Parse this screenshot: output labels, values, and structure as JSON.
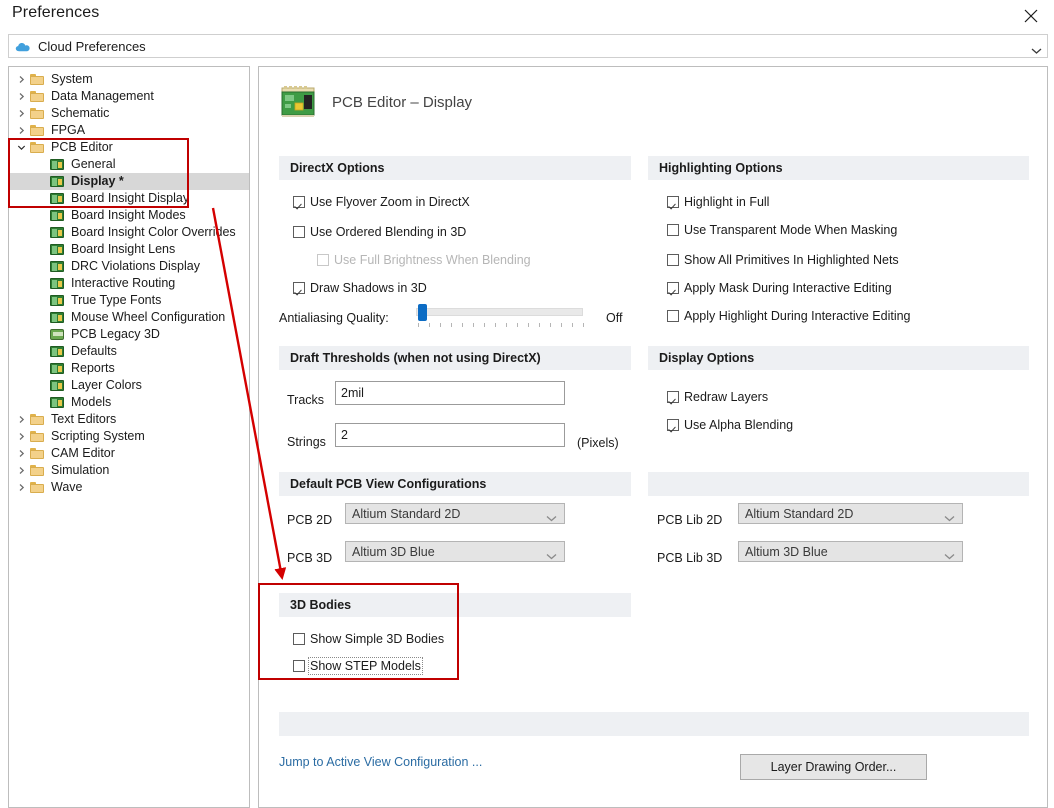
{
  "window": {
    "title": "Preferences",
    "close_icon": "close-icon"
  },
  "cloud_bar": {
    "label": "Cloud Preferences",
    "icon": "cloud-icon",
    "chevron_icon": "chevron-down-icon"
  },
  "tree": {
    "items": [
      {
        "label": "System",
        "icon": "folder-icon",
        "indent": 0,
        "expander": "collapsed",
        "selected": false
      },
      {
        "label": "Data Management",
        "icon": "folder-icon",
        "indent": 0,
        "expander": "collapsed",
        "selected": false
      },
      {
        "label": "Schematic",
        "icon": "folder-icon",
        "indent": 0,
        "expander": "collapsed",
        "selected": false
      },
      {
        "label": "FPGA",
        "icon": "folder-icon",
        "indent": 0,
        "expander": "collapsed",
        "selected": false
      },
      {
        "label": "PCB Editor",
        "icon": "folder-icon",
        "indent": 0,
        "expander": "expanded",
        "selected": false
      },
      {
        "label": "General",
        "icon": "pcb-chip-icon",
        "indent": 1,
        "expander": "none",
        "selected": false
      },
      {
        "label": "Display *",
        "icon": "pcb-chip-icon",
        "indent": 1,
        "expander": "none",
        "selected": true
      },
      {
        "label": "Board Insight Display",
        "icon": "pcb-chip-icon",
        "indent": 1,
        "expander": "none",
        "selected": false
      },
      {
        "label": "Board Insight Modes",
        "icon": "pcb-chip-icon",
        "indent": 1,
        "expander": "none",
        "selected": false
      },
      {
        "label": "Board Insight Color Overrides",
        "icon": "pcb-chip-icon",
        "indent": 1,
        "expander": "none",
        "selected": false
      },
      {
        "label": "Board Insight Lens",
        "icon": "pcb-chip-icon",
        "indent": 1,
        "expander": "none",
        "selected": false
      },
      {
        "label": "DRC Violations Display",
        "icon": "pcb-chip-icon",
        "indent": 1,
        "expander": "none",
        "selected": false
      },
      {
        "label": "Interactive Routing",
        "icon": "pcb-chip-icon",
        "indent": 1,
        "expander": "none",
        "selected": false
      },
      {
        "label": "True Type Fonts",
        "icon": "pcb-chip-icon",
        "indent": 1,
        "expander": "none",
        "selected": false
      },
      {
        "label": "Mouse Wheel Configuration",
        "icon": "pcb-chip-icon",
        "indent": 1,
        "expander": "none",
        "selected": false
      },
      {
        "label": "PCB Legacy 3D",
        "icon": "pcb-3d-icon",
        "indent": 1,
        "expander": "none",
        "selected": false
      },
      {
        "label": "Defaults",
        "icon": "pcb-chip-icon",
        "indent": 1,
        "expander": "none",
        "selected": false
      },
      {
        "label": "Reports",
        "icon": "pcb-chip-icon",
        "indent": 1,
        "expander": "none",
        "selected": false
      },
      {
        "label": "Layer Colors",
        "icon": "pcb-chip-icon",
        "indent": 1,
        "expander": "none",
        "selected": false
      },
      {
        "label": "Models",
        "icon": "pcb-chip-icon",
        "indent": 1,
        "expander": "none",
        "selected": false
      },
      {
        "label": "Text Editors",
        "icon": "folder-icon",
        "indent": 0,
        "expander": "collapsed",
        "selected": false
      },
      {
        "label": "Scripting System",
        "icon": "folder-icon",
        "indent": 0,
        "expander": "collapsed",
        "selected": false
      },
      {
        "label": "CAM Editor",
        "icon": "folder-icon",
        "indent": 0,
        "expander": "collapsed",
        "selected": false
      },
      {
        "label": "Simulation",
        "icon": "folder-icon",
        "indent": 0,
        "expander": "collapsed",
        "selected": false
      },
      {
        "label": "Wave",
        "icon": "folder-icon",
        "indent": 0,
        "expander": "collapsed",
        "selected": false
      }
    ]
  },
  "page": {
    "title": "PCB Editor – Display",
    "icon": "pcb-board-icon"
  },
  "directx": {
    "heading": "DirectX Options",
    "options": [
      {
        "label": "Use Flyover Zoom in DirectX",
        "checked": true,
        "disabled": false
      },
      {
        "label": "Use Ordered Blending in 3D",
        "checked": false,
        "disabled": false
      },
      {
        "label": "Use Full Brightness When Blending",
        "checked": false,
        "disabled": true
      },
      {
        "label": "Draw Shadows in 3D",
        "checked": true,
        "disabled": false
      }
    ],
    "antialiasing_label": "Antialiasing Quality:",
    "antialiasing_value": "Off",
    "antialiasing_position_percent": 0,
    "antialiasing_ticks": 16
  },
  "highlighting": {
    "heading": "Highlighting Options",
    "options": [
      {
        "label": "Highlight in Full",
        "checked": true
      },
      {
        "label": "Use Transparent Mode When Masking",
        "checked": false
      },
      {
        "label": "Show All Primitives In Highlighted Nets",
        "checked": false
      },
      {
        "label": "Apply Mask During Interactive Editing",
        "checked": true
      },
      {
        "label": "Apply Highlight During Interactive Editing",
        "checked": false
      }
    ]
  },
  "draft_thresholds": {
    "heading": "Draft Thresholds (when not using DirectX)",
    "tracks_label": "Tracks",
    "tracks_value": "2mil",
    "strings_label": "Strings",
    "strings_value": "2",
    "units_suffix": "(Pixels)"
  },
  "display_options": {
    "heading": "Display Options",
    "options": [
      {
        "label": "Redraw Layers",
        "checked": true
      },
      {
        "label": "Use Alpha Blending",
        "checked": true
      }
    ]
  },
  "view_configs": {
    "heading": "Default PCB View Configurations",
    "rows": [
      {
        "label": "PCB 2D",
        "value": "Altium Standard 2D"
      },
      {
        "label": "PCB 3D",
        "value": "Altium 3D Blue"
      }
    ]
  },
  "lib_configs": {
    "heading": "",
    "rows": [
      {
        "label": "PCB Lib 2D",
        "value": "Altium Standard 2D"
      },
      {
        "label": "PCB Lib 3D",
        "value": "Altium 3D Blue"
      }
    ]
  },
  "bodies_3d": {
    "heading": "3D Bodies",
    "options": [
      {
        "label": "Show Simple 3D Bodies",
        "checked": false,
        "focused": false
      },
      {
        "label": "Show STEP Models",
        "checked": false,
        "focused": true
      }
    ]
  },
  "footer": {
    "jump_link": "Jump to Active View Configuration ...",
    "layer_button": "Layer Drawing Order..."
  },
  "annotations": {
    "highlight_color": "#c00000",
    "arrow_color": "#d40000",
    "boxes": [
      {
        "name": "tree-highlight-box"
      },
      {
        "name": "3d-bodies-highlight-box"
      }
    ],
    "arrow": {
      "name": "pointer-arrow"
    }
  },
  "colors": {
    "band_background": "#eef0f3",
    "selection": "#d7d7d7",
    "link": "#2b6ca3",
    "slider_thumb": "#0c6cc4",
    "annotation_red": "#c00000"
  }
}
